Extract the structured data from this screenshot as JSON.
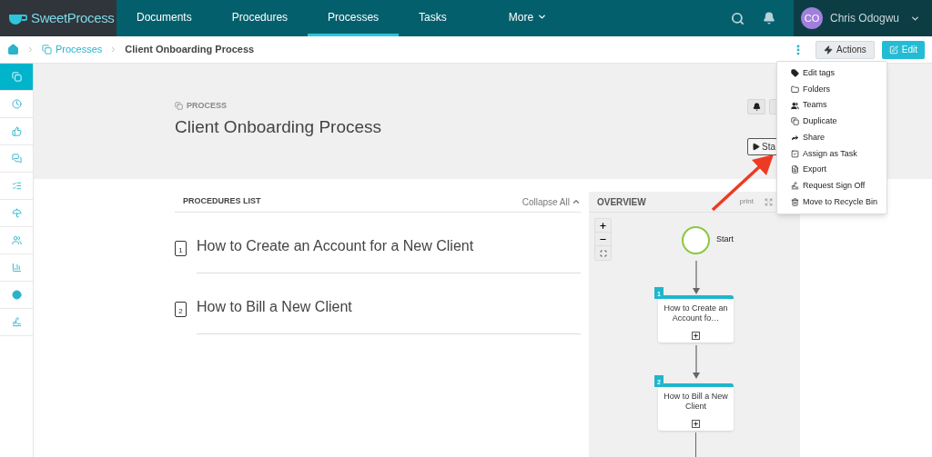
{
  "logo": "Sweet**Process**",
  "nav": [
    {
      "label": "Documents",
      "selected": false
    },
    {
      "label": "Procedures",
      "selected": false
    },
    {
      "label": "Processes",
      "selected": true
    },
    {
      "label": "Tasks",
      "selected": false
    },
    {
      "label": "More",
      "selected": false
    }
  ],
  "user": {
    "initials": "CO",
    "name": "Chris Odogwu"
  },
  "breadcrumb": [
    {
      "label": "Processes"
    },
    {
      "label": "Client Onboarding Process"
    }
  ],
  "toolbar": {
    "actions": "Actions",
    "edit": "Edit"
  },
  "sidebar": {
    "items": [
      {
        "selected": true
      },
      {
        "selected": false
      },
      {
        "selected": false
      },
      {
        "selected": false
      },
      {
        "selected": false
      },
      {
        "selected": false
      },
      {
        "selected": false
      },
      {
        "selected": false
      },
      {
        "selected": false
      },
      {
        "selected": false
      }
    ]
  },
  "header": {
    "kind_label": "PROCESS",
    "title": "Client Onboarding Process",
    "start_button": "Sta"
  },
  "procedures": {
    "title": "PROCEDURES LIST",
    "collapse": "Collapse All",
    "items": [
      {
        "number": "1",
        "title": "How to Create an Account for a New Client"
      },
      {
        "number": "2",
        "title": "How to Bill a New Client"
      }
    ]
  },
  "overview": {
    "title": "OVERVIEW",
    "print": "print",
    "start": "Start",
    "nodes": [
      {
        "number": "1",
        "title": "How to Create an Account fo…"
      },
      {
        "number": "2",
        "title": "How to Bill a New Client"
      }
    ]
  },
  "actions_menu": [
    "Edit tags",
    "Folders",
    "Teams",
    "Duplicate",
    "Share",
    "Assign as Task",
    "Export",
    "Request Sign Off",
    "Move to Recycle Bin"
  ]
}
